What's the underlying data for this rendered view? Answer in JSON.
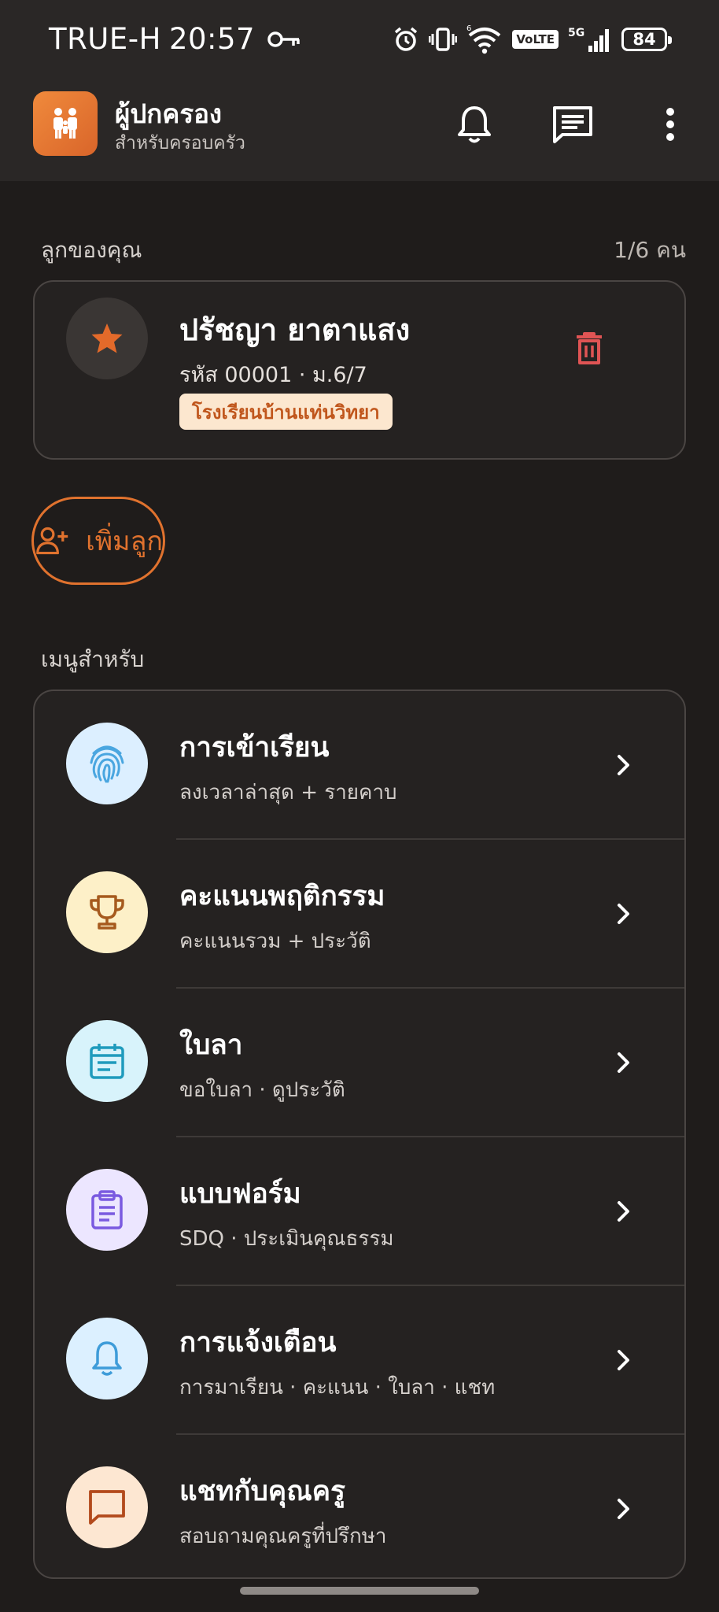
{
  "status_bar": {
    "carrier": "TRUE-H",
    "time": "20:57",
    "network_type": "5G",
    "volte": "VoLTE",
    "signal_sup": "6",
    "battery": "84"
  },
  "app_bar": {
    "title": "ผู้ปกครอง",
    "subtitle": "สำหรับครอบครัว"
  },
  "children": {
    "label": "ลูกของคุณ",
    "count": "1/6 คน",
    "items": [
      {
        "name": "ปรัชญา ยาตาแสง",
        "meta": "รหัส 00001 · ม.6/7",
        "school": "โรงเรียนบ้านแท่นวิทยา"
      }
    ],
    "add_label": "เพิ่มลูก"
  },
  "menu": {
    "label": "เมนูสำหรับ",
    "items": [
      {
        "title": "การเข้าเรียน",
        "subtitle": "ลงเวลาล่าสุด + รายคาบ",
        "icon": "fingerprint-icon",
        "bg": "#dcefff",
        "fg": "#4aa6e0"
      },
      {
        "title": "คะแนนพฤติกรรม",
        "subtitle": "คะแนนรวม + ประวัติ",
        "icon": "trophy-icon",
        "bg": "#fdf0c8",
        "fg": "#a65a1e"
      },
      {
        "title": "ใบลา",
        "subtitle": "ขอใบลา · ดูประวัติ",
        "icon": "calendar-icon",
        "bg": "#d8f3fb",
        "fg": "#1f9bbd"
      },
      {
        "title": "แบบฟอร์ม",
        "subtitle": "SDQ · ประเมินคุณธรรม",
        "icon": "clipboard-icon",
        "bg": "#ece6ff",
        "fg": "#7a5ae0"
      },
      {
        "title": "การแจ้งเตือน",
        "subtitle": "การมาเรียน · คะแนน · ใบลา · แชท",
        "icon": "bell-icon",
        "bg": "#dcf0ff",
        "fg": "#3e9cd9"
      },
      {
        "title": "แชทกับคุณครู",
        "subtitle": "สอบถามคุณครูที่ปรึกษา",
        "icon": "chat-icon",
        "bg": "#fde7d2",
        "fg": "#b34a1c"
      }
    ]
  },
  "colors": {
    "accent": "#e0722e",
    "danger": "#e05454",
    "background": "#1f1c1b",
    "surface": "#252221"
  }
}
